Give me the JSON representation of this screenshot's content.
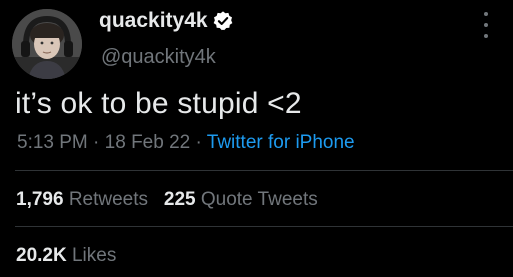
{
  "tweet": {
    "author": {
      "name": "quackity4k",
      "handle": "@quackity4k",
      "verified": true,
      "avatar_icon": "profile-photo"
    },
    "text": "it’s ok to be stupid <2",
    "time": "5:13 PM",
    "separator": "·",
    "date": "18 Feb 22",
    "source": "Twitter for iPhone",
    "stats": {
      "retweets_count": "1,796",
      "retweets_label": "Retweets",
      "quote_count": "225",
      "quote_label": "Quote Tweets",
      "likes_count": "20.2K",
      "likes_label": "Likes"
    }
  },
  "colors": {
    "background": "#000000",
    "primary_text": "#e7e9ea",
    "secondary_text": "#71767b",
    "link": "#1d9bf0",
    "divider": "#2f3336"
  },
  "icons": {
    "verified": "verified-badge-icon",
    "more": "more-options-icon"
  }
}
